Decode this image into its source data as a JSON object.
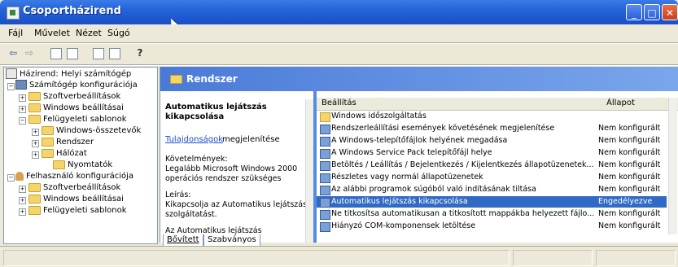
{
  "window": {
    "title": "Csoportházirend"
  },
  "menu": [
    "Fájl",
    "Művelet",
    "Nézet",
    "Súgó"
  ],
  "tree": {
    "root": "Házirend: Helyi számítógép",
    "computer_config": "Számítógép konfigurációja",
    "software_settings": "Szoftverbeállítások",
    "windows_settings": "Windows beállításai",
    "admin_templates": "Felügyeleti sablonok",
    "windows_components": "Windows-összetevők",
    "system": "Rendszer",
    "network": "Hálózat",
    "printers": "Nyomtatók",
    "user_config": "Felhasználó konfigurációja",
    "user_software": "Szoftverbeállítások",
    "user_windows": "Windows beállításai",
    "user_admin": "Felügyeleti sablonok"
  },
  "pane": {
    "title": "Rendszer"
  },
  "description": {
    "title": "Automatikus lejátszás kikapcsolása",
    "props_link": "Tulajdonságok",
    "props_rest": "megjelenítése",
    "requirements_label": "Követelmények:",
    "requirements": "Legalább Microsoft Windows 2000 operációs rendszer szükséges",
    "desc_label": "Leírás:",
    "desc_text": "Kikapcsolja az Automatikus lejátszás szolgáltatást.",
    "desc_more": "Az Automatikus lejátszás szolgáltatás"
  },
  "tabs": {
    "extended": "Bővített",
    "standard": "Szabványos"
  },
  "list": {
    "col_setting": "Beállítás",
    "col_state": "Állapot",
    "rows": [
      {
        "name": "Windows időszolgáltatás",
        "state": ""
      },
      {
        "name": "Rendszerleállítási események követésének megjelenítése",
        "state": "Nem konfigurált"
      },
      {
        "name": "A Windows-telepítőfájlok helyének megadása",
        "state": "Nem konfigurált"
      },
      {
        "name": "A Windows Service Pack telepítőfájl helye",
        "state": "Nem konfigurált"
      },
      {
        "name": "Betöltés / Leállítás / Bejelentkezés / Kijelentkezés állapotüzenetek...",
        "state": "Nem konfigurált"
      },
      {
        "name": "Részletes vagy normál állapotüzenetek",
        "state": "Nem konfigurált"
      },
      {
        "name": "Az alábbi programok súgóból való indításának tiltása",
        "state": "Nem konfigurált"
      },
      {
        "name": "Automatikus lejátszás kikapcsolása",
        "state": "Engedélyezve"
      },
      {
        "name": "Ne titkosítsa automatikusan a titkosított mappákba helyezett fájlo...",
        "state": "Nem konfigurált"
      },
      {
        "name": "Hiányzó COM-komponensek letöltése",
        "state": "Nem konfigurált"
      }
    ]
  }
}
